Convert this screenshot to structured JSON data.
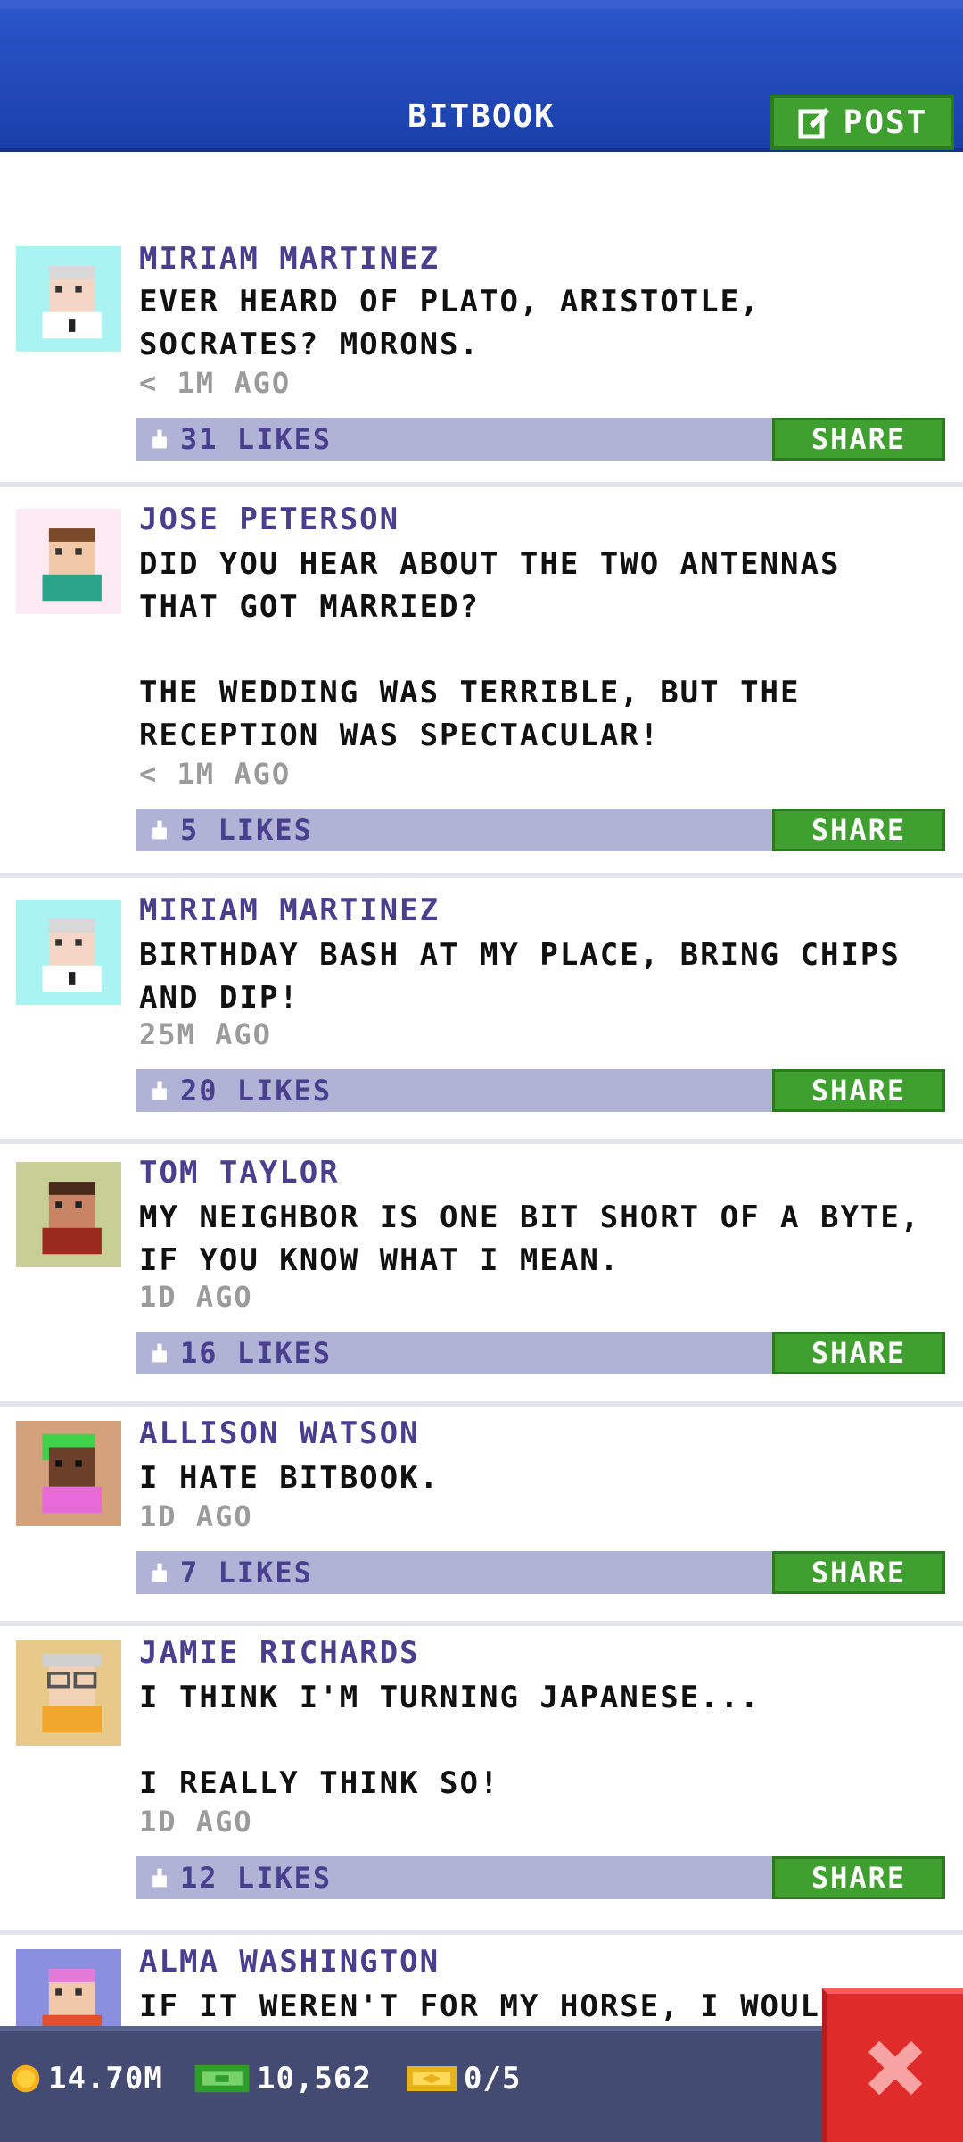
{
  "header": {
    "title": "BITBOOK",
    "post_label": "POST"
  },
  "posts": [
    {
      "author": "MIRIAM MARTINEZ",
      "text": "EVER HEARD OF PLATO, ARISTOTLE,\nSOCRATES? MORONS.",
      "time": "< 1M AGO",
      "likes": "31 LIKES",
      "share": "SHARE",
      "avatar_color": "#a9f3f3"
    },
    {
      "author": "JOSE PETERSON",
      "text": "DID YOU HEAR ABOUT THE TWO ANTENNAS\nTHAT GOT MARRIED?\n\nTHE WEDDING WAS TERRIBLE, BUT THE\nRECEPTION WAS SPECTACULAR!",
      "time": "< 1M AGO",
      "likes": "5 LIKES",
      "share": "SHARE",
      "avatar_color": "#fdeaf3"
    },
    {
      "author": "MIRIAM MARTINEZ",
      "text": "BIRTHDAY BASH AT MY PLACE, BRING CHIPS\nAND DIP!",
      "time": "25M AGO",
      "likes": "20 LIKES",
      "share": "SHARE",
      "avatar_color": "#a9f3f3"
    },
    {
      "author": "TOM TAYLOR",
      "text": "MY NEIGHBOR IS ONE BIT SHORT OF A BYTE,\nIF YOU KNOW WHAT I MEAN.",
      "time": "1D AGO",
      "likes": "16 LIKES",
      "share": "SHARE",
      "avatar_color": "#c7cf96"
    },
    {
      "author": "ALLISON WATSON",
      "text": "I HATE BITBOOK.",
      "time": "1D AGO",
      "likes": "7 LIKES",
      "share": "SHARE",
      "avatar_color": "#d4a17d"
    },
    {
      "author": "JAMIE RICHARDS",
      "text": "I THINK I'M TURNING JAPANESE...\n\nI REALLY THINK SO!",
      "time": "1D AGO",
      "likes": "12 LIKES",
      "share": "SHARE",
      "avatar_color": "#e9c98a"
    },
    {
      "author": "ALMA WASHINGTON",
      "text": "IF IT WEREN'T FOR MY HORSE, I WOULDN",
      "time": "",
      "likes": "",
      "share": "",
      "avatar_color": "#8a8fe0"
    }
  ],
  "status_bar": {
    "coins": "14.70M",
    "bux": "10,562",
    "tickets": "0/5"
  },
  "colors": {
    "header": "#1a3faa",
    "green": "#3fa02f",
    "likes_bar": "#b0b2d6",
    "author": "#4a3f8f",
    "close": "#e02b2b"
  }
}
